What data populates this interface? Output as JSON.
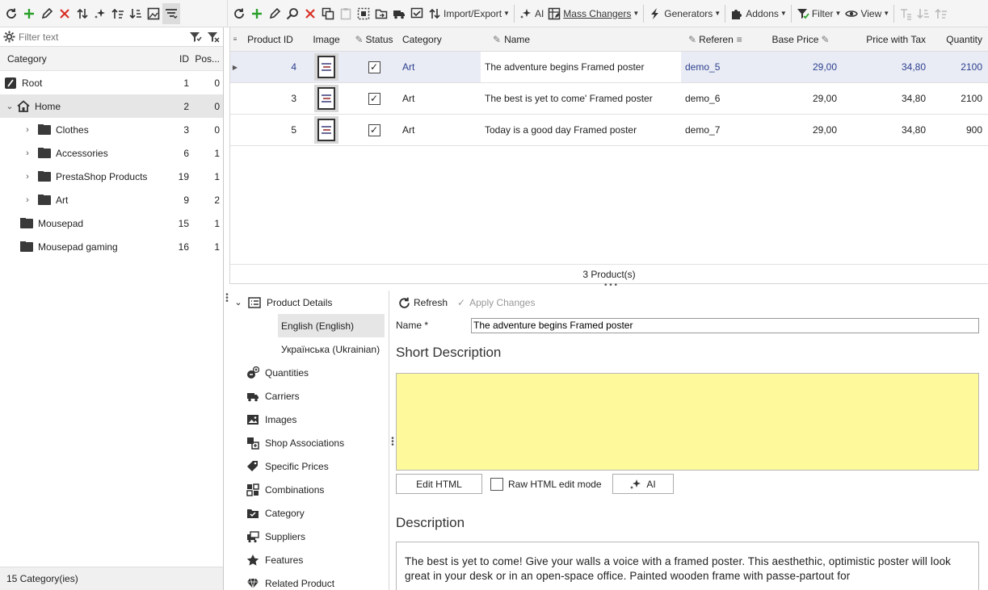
{
  "left_toolbar": {
    "icons": [
      "refresh-icon",
      "add-icon",
      "edit-icon",
      "delete-icon",
      "sort-icon",
      "ai-sparkle-icon",
      "move-up-icon",
      "move-down-icon",
      "image-icon",
      "filter-list-icon"
    ]
  },
  "right_toolbar": {
    "import_export": "Import/Export",
    "ai": "AI",
    "mass_changers": "Mass Changers",
    "generators": "Generators",
    "addons": "Addons",
    "filter": "Filter",
    "view": "View"
  },
  "filter": {
    "placeholder": "Filter text"
  },
  "category_tree": {
    "columns": {
      "category": "Category",
      "id": "ID",
      "position": "Pos..."
    },
    "rows": [
      {
        "name": "Root",
        "id": "1",
        "pos": "0"
      },
      {
        "name": "Home",
        "id": "2",
        "pos": "0"
      },
      {
        "name": "Clothes",
        "id": "3",
        "pos": "0"
      },
      {
        "name": "Accessories",
        "id": "6",
        "pos": "1"
      },
      {
        "name": "PrestaShop Products",
        "id": "19",
        "pos": "1"
      },
      {
        "name": "Art",
        "id": "9",
        "pos": "2"
      },
      {
        "name": "Mousepad",
        "id": "15",
        "pos": "1"
      },
      {
        "name": "Mousepad gaming",
        "id": "16",
        "pos": "1"
      }
    ],
    "status": "15 Category(ies)"
  },
  "product_grid": {
    "columns": {
      "product_id": "Product ID",
      "image": "Image",
      "status": "Status",
      "category": "Category",
      "name": "Name",
      "reference": "Referen",
      "base_price": "Base Price",
      "price_tax": "Price with Tax",
      "quantity": "Quantity"
    },
    "rows": [
      {
        "id": "4",
        "status_checked": true,
        "category": "Art",
        "name": "The adventure begins Framed poster",
        "reference": "demo_5",
        "base_price": "29,00",
        "price_tax": "34,80",
        "quantity": "2100"
      },
      {
        "id": "3",
        "status_checked": true,
        "category": "Art",
        "name": "The best is yet to come' Framed poster",
        "reference": "demo_6",
        "base_price": "29,00",
        "price_tax": "34,80",
        "quantity": "2100"
      },
      {
        "id": "5",
        "status_checked": true,
        "category": "Art",
        "name": "Today is a good day Framed poster",
        "reference": "demo_7",
        "base_price": "29,00",
        "price_tax": "34,80",
        "quantity": "900"
      }
    ],
    "status": "3 Product(s)"
  },
  "nav": {
    "product_details": "Product Details",
    "english": "English (English)",
    "ukrainian": "Українська (Ukrainian)",
    "quantities": "Quantities",
    "carriers": "Carriers",
    "images": "Images",
    "shop_associations": "Shop Associations",
    "specific_prices": "Specific Prices",
    "combinations": "Combinations",
    "category": "Category",
    "suppliers": "Suppliers",
    "features": "Features",
    "related_product": "Related Product"
  },
  "editor": {
    "refresh": "Refresh",
    "apply_changes": "Apply Changes",
    "name_label": "Name *",
    "name_value": "The adventure begins Framed poster",
    "short_description_title": "Short Description",
    "edit_html": "Edit HTML",
    "raw_html_mode": "Raw HTML edit mode",
    "ai": "AI",
    "description_title": "Description",
    "description_text": "The best is yet to come! Give your walls a voice with a framed poster. This aesthethic, optimistic poster will look great in your desk or in an open-space office. Painted wooden frame with passe-partout for"
  },
  "colors": {
    "accent_blue": "#2c3f8f",
    "short_desc_bg": "#fefa9c",
    "add_green": "#2aa02a",
    "delete_red": "#d93025"
  }
}
